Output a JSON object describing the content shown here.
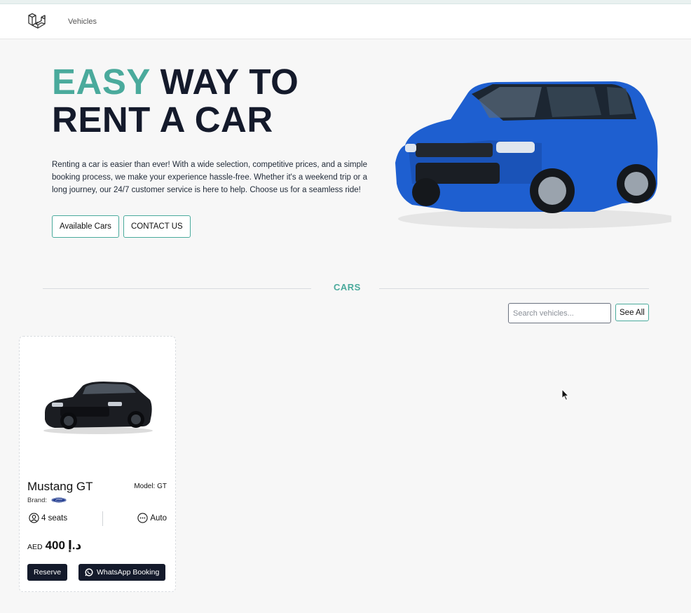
{
  "nav": {
    "logo_icon": "laravel-logo-icon",
    "link_vehicles": "Vehicles"
  },
  "hero": {
    "title_accent": "EASY",
    "title_rest_line1": " WAY TO",
    "title_line2": "RENT A CAR",
    "description": "Renting a car is easier than ever! With a wide selection, competitive prices, and a simple booking process, we make your experience hassle-free. Whether it's a weekend trip or a long journey, our 24/7 customer service is here to help. Choose us for a seamless ride!",
    "btn_available_cars": "Available Cars",
    "btn_contact": "CONTACT US",
    "image": "blue-suv-car-image"
  },
  "cars_section": {
    "title": "CARS",
    "search_placeholder": "Search vehicles...",
    "btn_see_all": "See All"
  },
  "vehicles": [
    {
      "name": "Mustang GT",
      "model_label": "Model: GT",
      "brand_label": "Brand:",
      "brand_logo": "ford-logo-icon",
      "seats": "4 seats",
      "transmission": "Auto",
      "price_currency": "AED",
      "price_value": "400",
      "price_symbol": "د.إ",
      "btn_reserve": "Reserve",
      "btn_whatsapp": "WhatsApp Booking",
      "image": "black-mustang-car-image"
    }
  ],
  "colors": {
    "accent": "#4aaa9c",
    "dark": "#141a2b",
    "background": "#f7f7f7"
  }
}
